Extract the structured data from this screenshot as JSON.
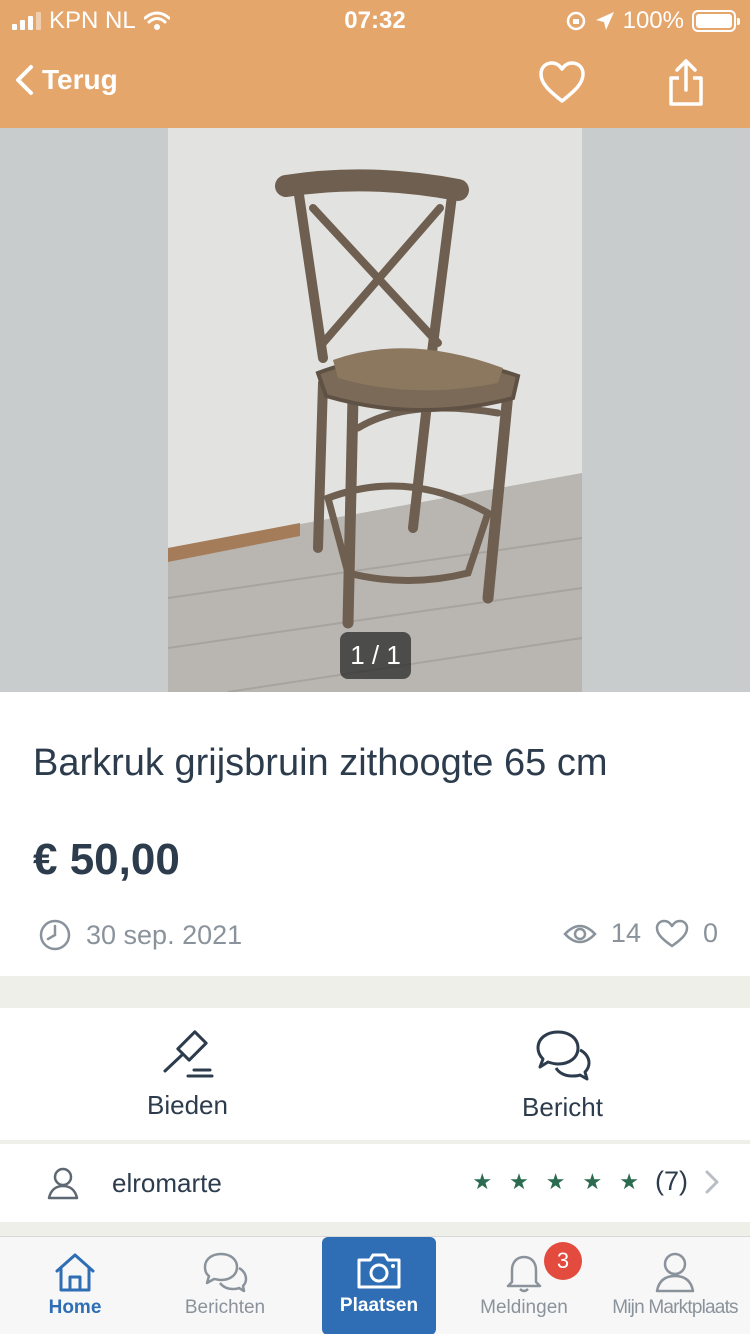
{
  "status_bar": {
    "carrier": "KPN NL",
    "time": "07:32",
    "battery": "100%"
  },
  "navbar": {
    "back_label": "Terug"
  },
  "gallery": {
    "counter": "1 / 1"
  },
  "listing": {
    "title": "Barkruk grijsbruin zithoogte  65 cm",
    "price": "€ 50,00",
    "date": "30 sep. 2021",
    "views": "14",
    "favorites": "0"
  },
  "actions": {
    "bid_label": "Bieden",
    "message_label": "Bericht"
  },
  "seller": {
    "name": "elromarte",
    "rating_stars": 5,
    "review_count": "(7)"
  },
  "tabbar": {
    "home": "Home",
    "messages": "Berichten",
    "place": "Plaatsen",
    "notifications": "Meldingen",
    "notifications_badge": "3",
    "my": "Mijn Marktplaats"
  },
  "colors": {
    "header": "#e5a66c",
    "accent": "#2f6db5",
    "star": "#2b6b4f",
    "badge": "#e34b3e"
  }
}
